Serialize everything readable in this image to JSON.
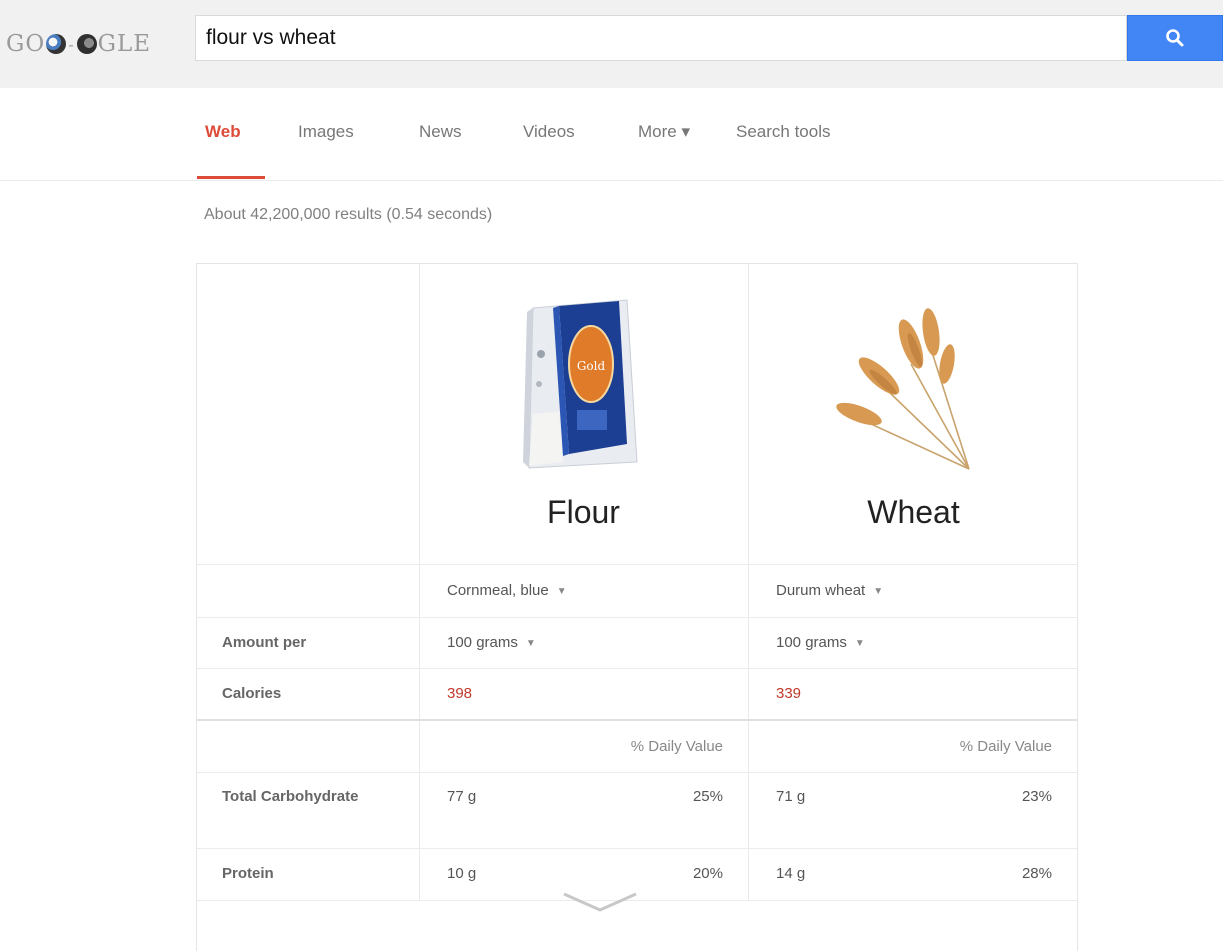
{
  "header": {
    "logo_left": "GO",
    "logo_dash": "-",
    "logo_right": "GLE",
    "search_value": "flour vs wheat",
    "search_icon": "search-icon"
  },
  "tabs": [
    {
      "label": "Web",
      "active": true
    },
    {
      "label": "Images",
      "active": false
    },
    {
      "label": "News",
      "active": false
    },
    {
      "label": "Videos",
      "active": false
    },
    {
      "label": "More ▾",
      "active": false
    },
    {
      "label": "Search tools",
      "active": false
    }
  ],
  "result_stats": "About 42,200,000 results (0.54 seconds)",
  "comparison": {
    "foods": [
      {
        "name": "Flour",
        "variety": "Cornmeal, blue",
        "amount": "100 grams",
        "calories": "398"
      },
      {
        "name": "Wheat",
        "variety": "Durum wheat",
        "amount": "100 grams",
        "calories": "339"
      }
    ],
    "labels": {
      "amount_per": "Amount per",
      "calories": "Calories",
      "daily_value": "% Daily Value"
    },
    "nutrients": [
      {
        "label": "Total Carbohydrate",
        "values": [
          {
            "amount": "77 g",
            "pct": "25%"
          },
          {
            "amount": "71 g",
            "pct": "23%"
          }
        ]
      },
      {
        "label": "Protein",
        "values": [
          {
            "amount": "10 g",
            "pct": "20%"
          },
          {
            "amount": "14 g",
            "pct": "28%"
          }
        ]
      }
    ],
    "product_logo_text": "Gold",
    "expand_icon": "chevron-down-icon"
  },
  "colors": {
    "accent_red": "#dd4b39",
    "search_blue": "#4285f4",
    "calorie_red": "#c0392b"
  }
}
